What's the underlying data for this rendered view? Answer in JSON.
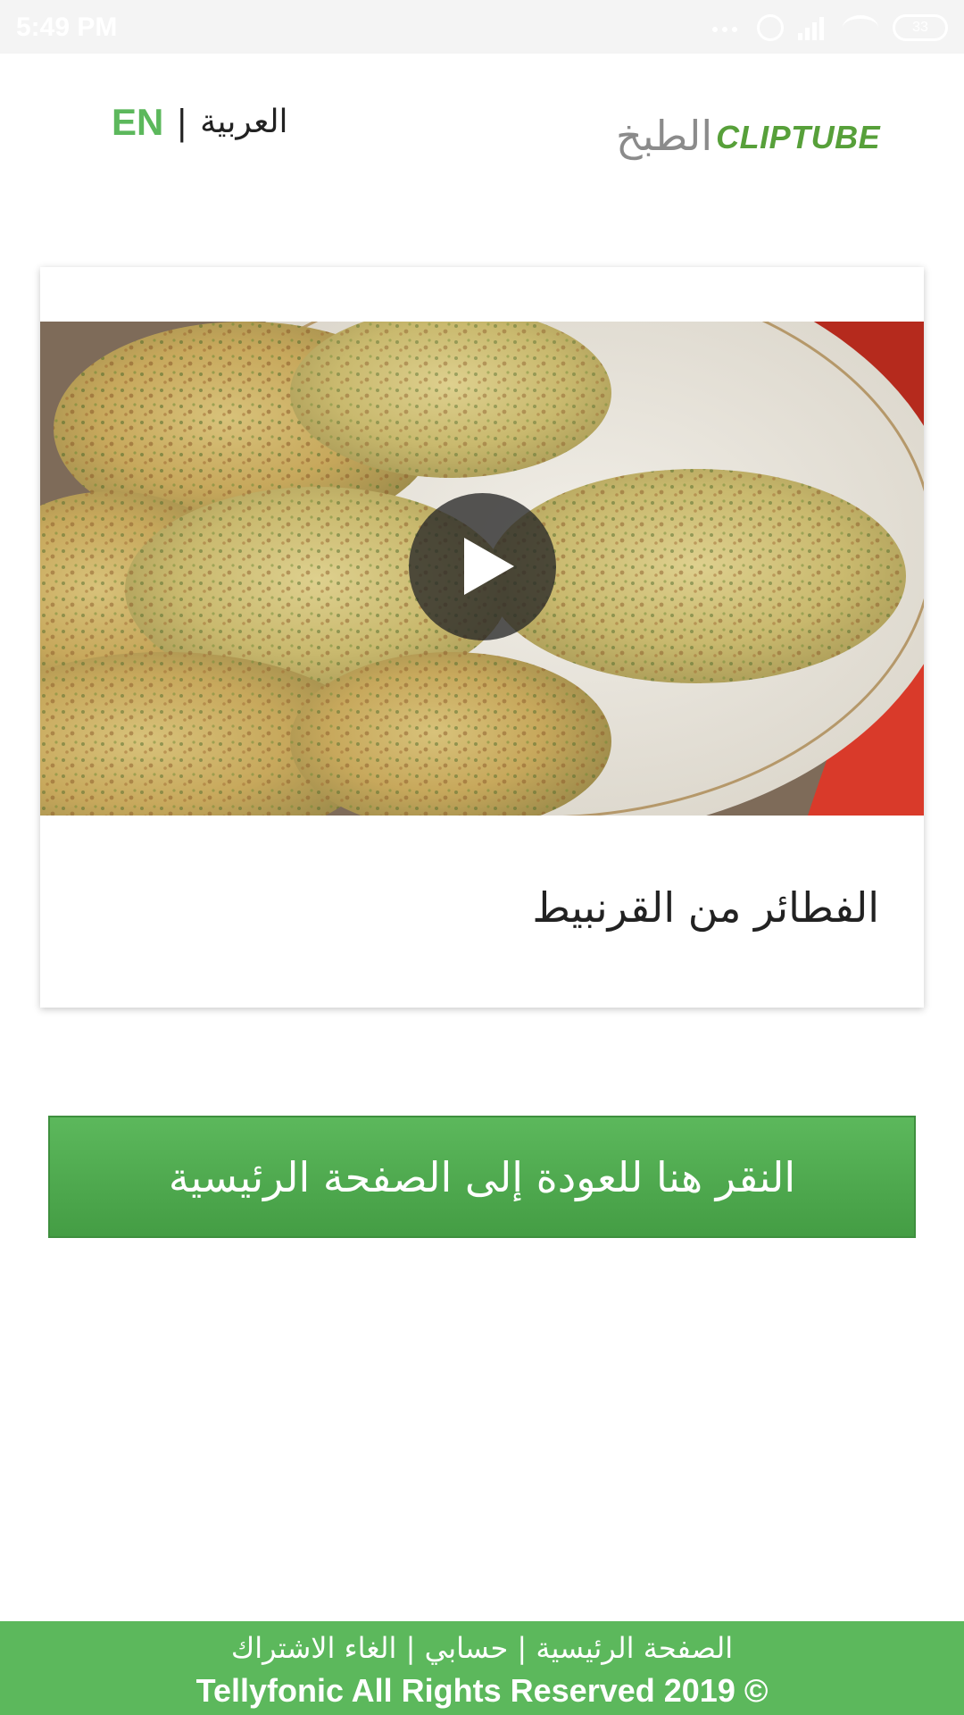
{
  "status_bar": {
    "time": "5:49 PM",
    "battery": "33",
    "icons": [
      "more-dots-icon",
      "alarm-icon",
      "signal-icon",
      "wifi-icon",
      "battery-icon"
    ]
  },
  "header": {
    "lang_en": "EN",
    "lang_separator": "|",
    "lang_ar": "العربية",
    "logo_en": "CLIPTUBE",
    "logo_ar": "الطبخ"
  },
  "video_card": {
    "title": "الفطائر من القرنبيط",
    "play_icon": "play-icon"
  },
  "back_button": {
    "label": "النقر هنا للعودة إلى الصفحة الرئيسية"
  },
  "footer": {
    "link_home": "الصفحة الرئيسية",
    "separator": "|",
    "link_account": "حسابي",
    "link_unsubscribe": "الغاء الاشتراك",
    "copyright": "Tellyfonic All Rights Reserved 2019 ©"
  },
  "colors": {
    "accent_green": "#5cb85c",
    "logo_green": "#57a03a",
    "logo_gray": "#8b8b8b"
  }
}
